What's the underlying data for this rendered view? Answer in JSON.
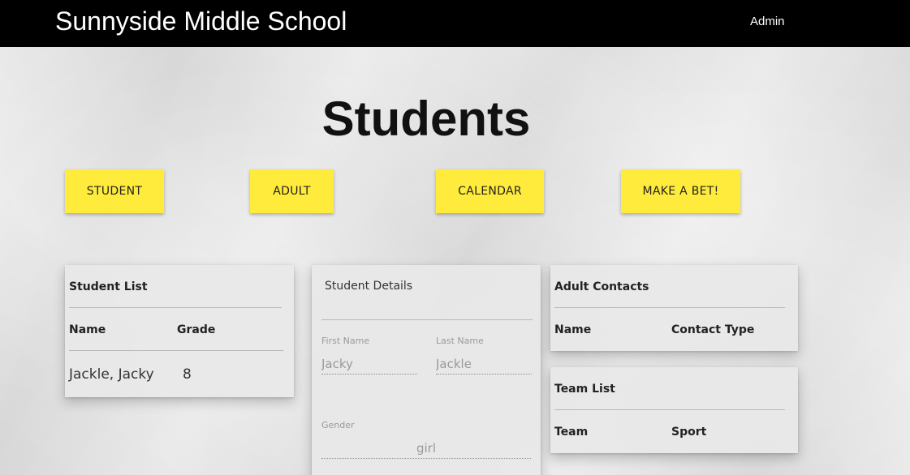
{
  "header": {
    "brand": "Sunnyside Middle School",
    "admin_label": "Admin"
  },
  "page": {
    "title": "Students"
  },
  "nav_buttons": {
    "student": "STUDENT",
    "adult": "ADULT",
    "calendar": "CALENDAR",
    "make_a_bet": "MAKE A BET!"
  },
  "student_list": {
    "title": "Student List",
    "columns": [
      "Name",
      "Grade"
    ],
    "rows": [
      {
        "name": "Jackle, Jacky",
        "grade": "8"
      }
    ]
  },
  "student_details": {
    "title": "Student Details",
    "first_name": {
      "label": "First Name",
      "value": "Jacky"
    },
    "last_name": {
      "label": "Last Name",
      "value": "Jackle"
    },
    "gender": {
      "label": "Gender",
      "value": "girl"
    }
  },
  "adult_contacts": {
    "title": "Adult Contacts",
    "columns": [
      "Name",
      "Contact Type"
    ]
  },
  "team_list": {
    "title": "Team List",
    "columns": [
      "Team",
      "Sport"
    ]
  },
  "colors": {
    "header_bg": "#000000",
    "button_yellow": "#ffeb3b"
  }
}
